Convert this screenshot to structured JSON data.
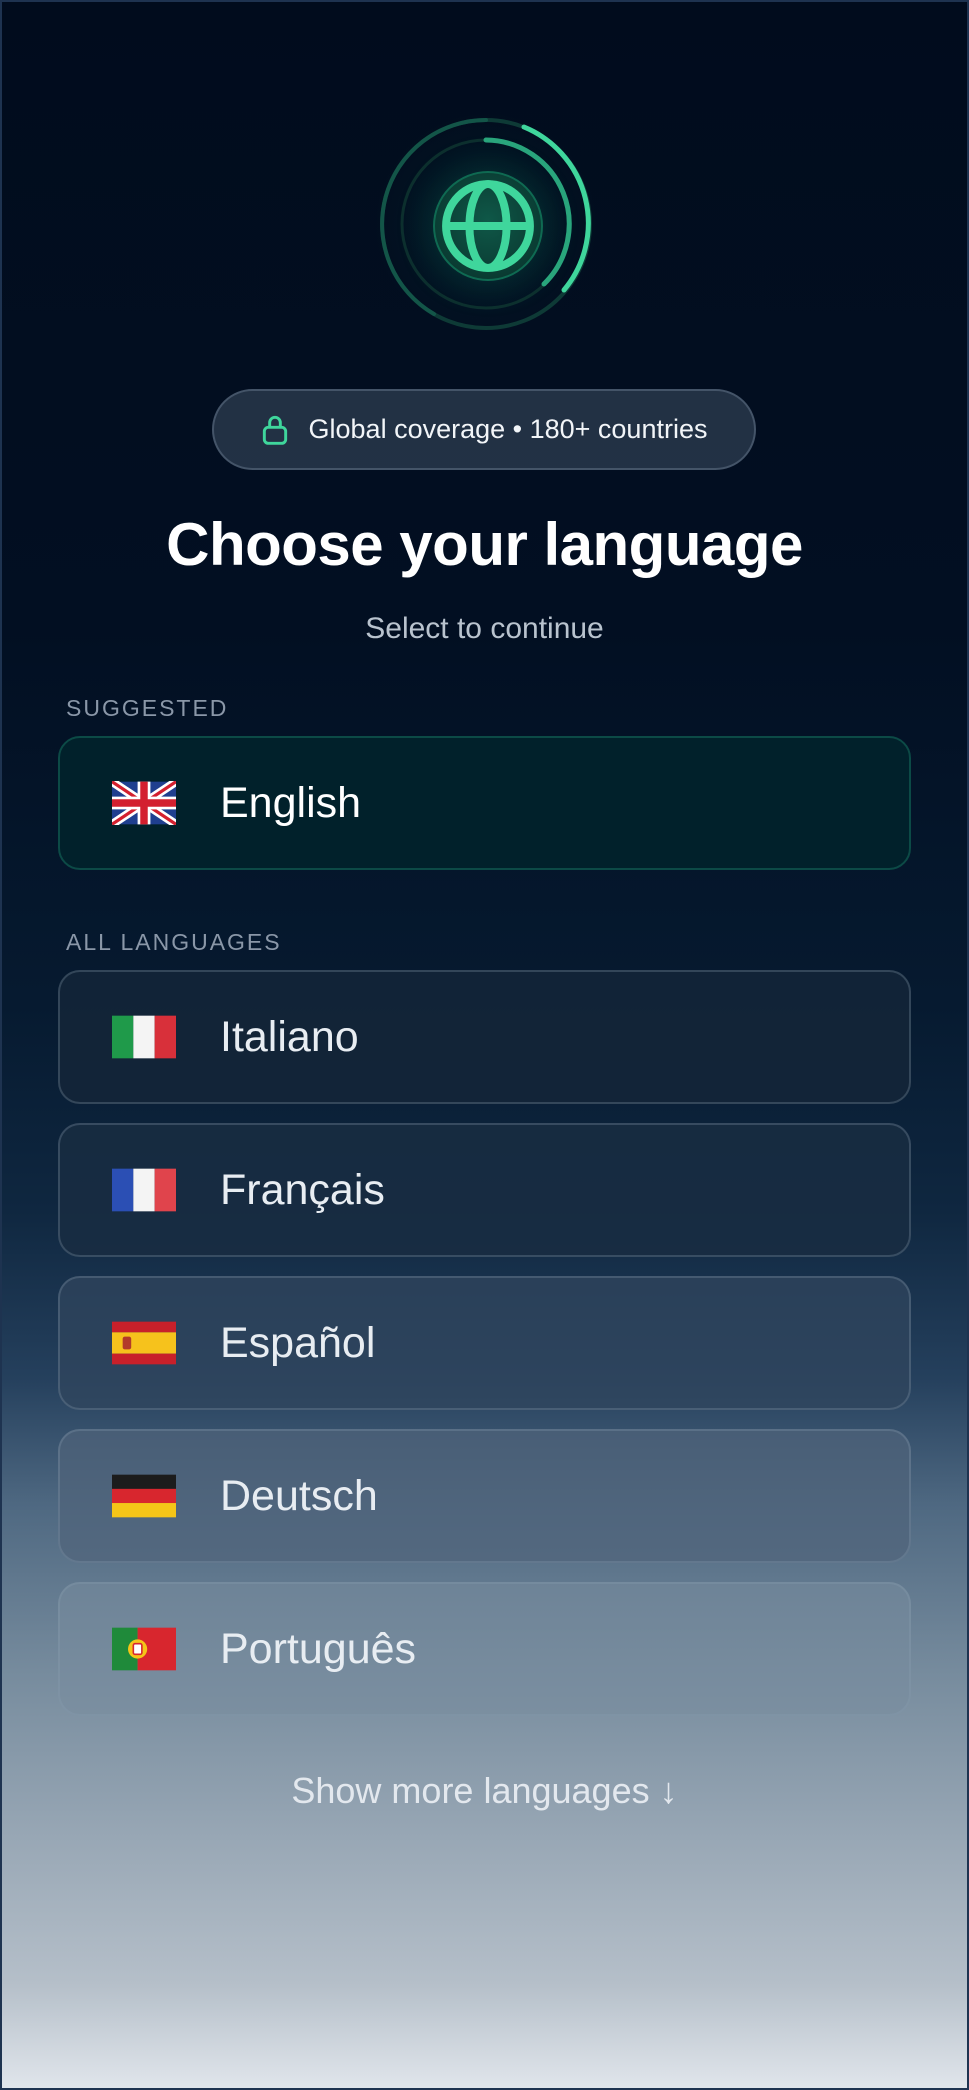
{
  "badge": {
    "icon": "lock-icon",
    "text": "Global coverage • 180+ countries"
  },
  "title": "Choose your language",
  "subtitle": "Select to continue",
  "sections": {
    "suggested_label": "SUGGESTED",
    "all_label": "ALL LANGUAGES"
  },
  "suggested": {
    "label": "English",
    "flag": "uk-flag"
  },
  "languages": [
    {
      "label": "Italiano",
      "flag": "italy-flag"
    },
    {
      "label": "Français",
      "flag": "france-flag"
    },
    {
      "label": "Español",
      "flag": "spain-flag"
    },
    {
      "label": "Deutsch",
      "flag": "germany-flag"
    },
    {
      "label": "Português",
      "flag": "portugal-flag"
    }
  ],
  "show_more": {
    "label": "Show more languages",
    "arrow": "↓"
  },
  "colors": {
    "accent": "#3fd69c",
    "suggested_bg": "#01212b"
  }
}
